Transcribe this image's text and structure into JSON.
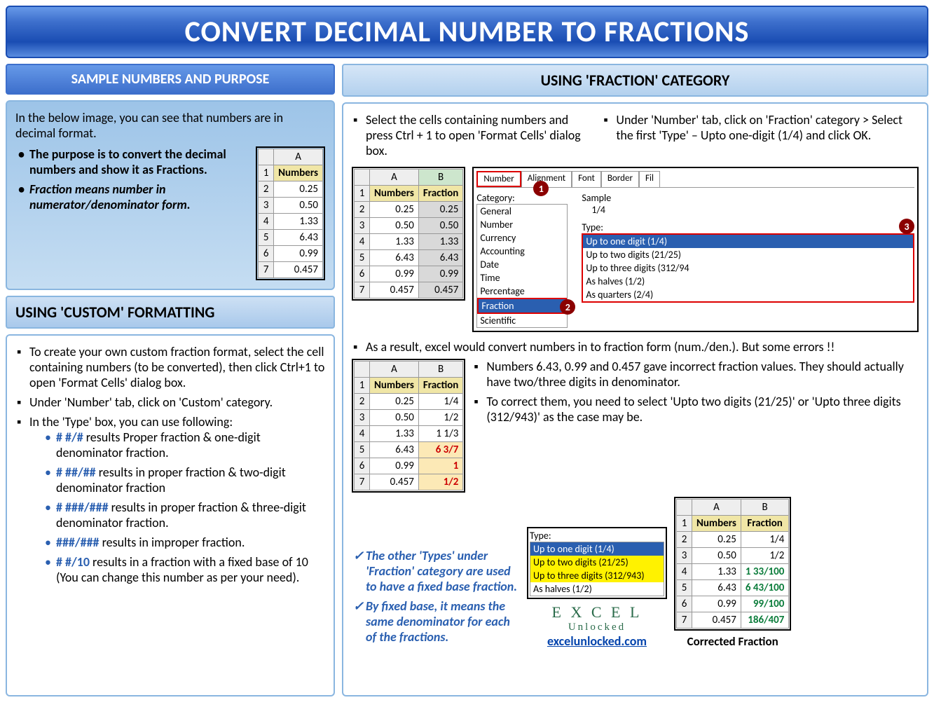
{
  "title": "CONVERT DECIMAL NUMBER TO FRACTIONS",
  "left": {
    "header1": "SAMPLE NUMBERS AND PURPOSE",
    "intro": "In the below image, you can see that numbers are in decimal format.",
    "b1": "The purpose is to convert the decimal numbers and show it as Fractions.",
    "b2": "Fraction means number in numerator/denominator form.",
    "sample_table": {
      "colA": "A",
      "header": "Numbers",
      "rows": [
        "0.25",
        "0.50",
        "1.33",
        "6.43",
        "0.99",
        "0.457"
      ]
    },
    "header2": "USING 'CUSTOM' FORMATTING",
    "c1": "To create your own custom fraction format, select the cell containing numbers (to be converted), then click Ctrl+1 to open 'Format Cells' dialog box.",
    "c2": "Under 'Number' tab, click on 'Custom' category.",
    "c3": "In the 'Type' box, you can use following:",
    "fmt1a": "# #/#",
    "fmt1b": " results Proper fraction & one-digit denominator fraction.",
    "fmt2a": "# ##/##",
    "fmt2b": " results in proper fraction & two-digit denominator fraction",
    "fmt3a": "# ###/###",
    "fmt3b": " results in proper fraction & three-digit denominator fraction.",
    "fmt4a": "###/###",
    "fmt4b": " results in improper fraction.",
    "fmt5a": "# #/10",
    "fmt5b": " results in a fraction with a fixed base of 10 (You can change this number as per your need)."
  },
  "right": {
    "header": "USING 'FRACTION' CATEGORY",
    "s1": "Select the cells containing numbers and press Ctrl + 1 to open 'Format Cells' dialog box.",
    "s2": "Under 'Number' tab, click on 'Fraction' category > Select the first 'Type' – Upto one-digit (1/4) and click OK.",
    "table1": {
      "colA": "A",
      "colB": "B",
      "h1": "Numbers",
      "h2": "Fraction",
      "rows": [
        {
          "a": "0.25",
          "b": "0.25"
        },
        {
          "a": "0.50",
          "b": "0.50"
        },
        {
          "a": "1.33",
          "b": "1.33"
        },
        {
          "a": "6.43",
          "b": "6.43"
        },
        {
          "a": "0.99",
          "b": "0.99"
        },
        {
          "a": "0.457",
          "b": "0.457"
        }
      ]
    },
    "dialog": {
      "tabs": [
        "Number",
        "Alignment",
        "Font",
        "Border",
        "Fil"
      ],
      "cat_label": "Category:",
      "cats": [
        "General",
        "Number",
        "Currency",
        "Accounting",
        "Date",
        "Time",
        "Percentage",
        "Fraction",
        "Scientific"
      ],
      "sample_label": "Sample",
      "sample_val": "1/4",
      "type_label": "Type:",
      "types": [
        "Up to one digit (1/4)",
        "Up to two digits (21/25)",
        "Up to three digits (312/94",
        "As halves (1/2)",
        "As quarters (2/4)"
      ],
      "n1": "1",
      "n2": "2",
      "n3": "3"
    },
    "s3": "As a result, excel would convert numbers in to fraction form (num./den.). But some errors !!",
    "table2": {
      "colA": "A",
      "colB": "B",
      "h1": "Numbers",
      "h2": "Fraction",
      "rows": [
        {
          "a": "0.25",
          "b": "1/4"
        },
        {
          "a": "0.50",
          "b": "1/2"
        },
        {
          "a": "1.33",
          "b": "1 1/3"
        },
        {
          "a": "6.43",
          "b": "6 3/7",
          "bad": true
        },
        {
          "a": "0.99",
          "b": "1",
          "bad": true
        },
        {
          "a": "0.457",
          "b": "1/2",
          "bad": true
        }
      ]
    },
    "s4": "Numbers 6.43, 0.99 and 0.457 gave incorrect fraction values. They should actually have two/three digits in denominator.",
    "s5": "To correct them, you need to select 'Upto  two digits (21/25)' or 'Upto three digits (312/943)' as the case may be.",
    "note1": "The other 'Types' under 'Fraction' category are used to have a fixed base fraction.",
    "note2": "By fixed base, it means the same denominator for each of the fractions.",
    "typebox": {
      "label": "Type:",
      "items": [
        "Up to one digit (1/4)",
        "Up to two digits (21/25)",
        "Up to three digits (312/943)",
        "As halves (1/2)"
      ]
    },
    "table3": {
      "colA": "A",
      "colB": "B",
      "h1": "Numbers",
      "h2": "Fraction",
      "rows": [
        {
          "a": "0.25",
          "b": "1/4"
        },
        {
          "a": "0.50",
          "b": "1/2"
        },
        {
          "a": "1.33",
          "b": "1   33/100",
          "good": true
        },
        {
          "a": "6.43",
          "b": "6   43/100",
          "good": true
        },
        {
          "a": "0.99",
          "b": "99/100",
          "good": true
        },
        {
          "a": "0.457",
          "b": "186/407",
          "good": true
        }
      ]
    },
    "caption": "Corrected Fraction",
    "logo1": "E X C E L",
    "logo2": "Unlocked",
    "url": "excelunlocked.com"
  }
}
